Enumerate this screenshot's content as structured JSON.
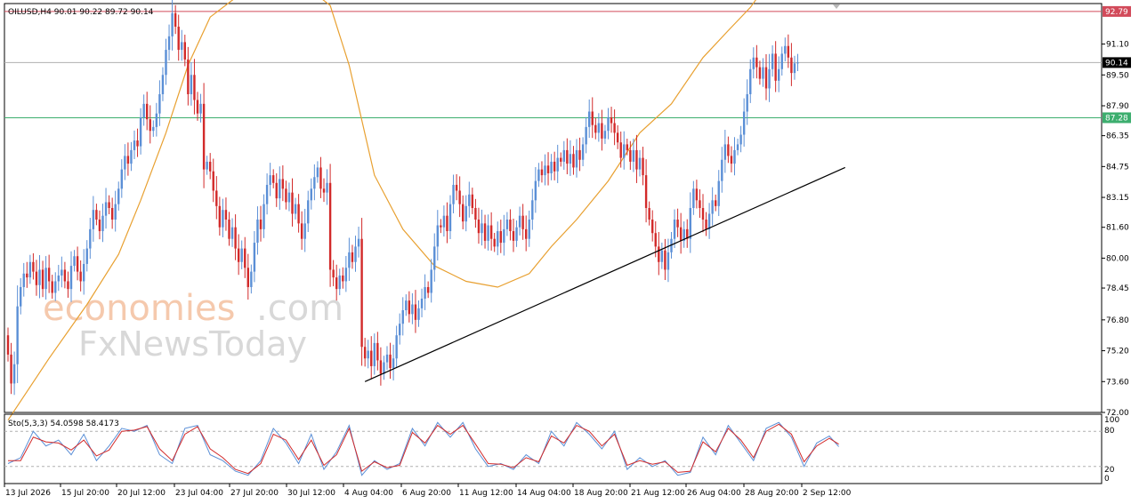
{
  "header": {
    "symbol_line": "OILUSD,H4  90.01 90.22 89.72 90.14",
    "stoch_line": "Sto(5,3,3) 54.0598 58.4173"
  },
  "watermark": {
    "brand_a": "economies",
    "brand_b": ".com",
    "brand_c": "FxNewsToday"
  },
  "colors": {
    "bull": "#5b8fd6",
    "bear": "#d22a2a",
    "ma": "#e8a030",
    "resistance": "#d24a5a",
    "support": "#3cae6e",
    "price_line": "#b0b0b0",
    "trend": "#000000",
    "stoch_main": "#5b8fd6",
    "stoch_signal": "#d22a2a"
  },
  "chart_data": {
    "type": "candlestick",
    "symbol": "OILUSD",
    "timeframe": "H4",
    "ohlc_last": {
      "open": 90.01,
      "high": 90.22,
      "low": 89.72,
      "close": 90.14
    },
    "ylim": [
      72.0,
      93.2
    ],
    "y_ticks": [
      "91.10",
      "89.50",
      "87.90",
      "86.35",
      "84.75",
      "83.15",
      "81.60",
      "80.00",
      "78.45",
      "76.80",
      "75.20",
      "73.60",
      "72.00"
    ],
    "x_ticks": [
      "13 Jul 2026",
      "15 Jul 20:00",
      "20 Jul 12:00",
      "23 Jul 04:00",
      "27 Jul 20:00",
      "30 Jul 12:00",
      "4 Aug 04:00",
      "6 Aug 20:00",
      "11 Aug 12:00",
      "14 Aug 04:00",
      "18 Aug 20:00",
      "21 Aug 12:00",
      "26 Aug 04:00",
      "28 Aug 20:00",
      "2 Sep 12:00"
    ],
    "levels": [
      {
        "label": "92.79",
        "value": 92.79,
        "kind": "resistance"
      },
      {
        "label": "90.14",
        "value": 90.14,
        "kind": "current"
      },
      {
        "label": "87.28",
        "value": 87.28,
        "kind": "support"
      }
    ],
    "closes": [
      75.0,
      73.5,
      74.5,
      77.5,
      78.5,
      79.2,
      79.0,
      79.8,
      79.3,
      78.6,
      79.4,
      78.4,
      79.5,
      78.8,
      78.2,
      78.8,
      79.1,
      79.4,
      78.8,
      78.4,
      79.6,
      80.1,
      79.3,
      78.8,
      79.7,
      80.5,
      81.5,
      82.5,
      82.0,
      81.4,
      82.2,
      82.9,
      82.6,
      82.0,
      82.8,
      83.6,
      84.6,
      85.3,
      84.9,
      85.6,
      86.1,
      85.8,
      87.3,
      88.0,
      87.2,
      86.6,
      86.8,
      87.5,
      88.5,
      89.5,
      90.8,
      91.5,
      92.7,
      92.0,
      90.8,
      91.2,
      90.3,
      88.5,
      89.5,
      88.2,
      87.5,
      88.0,
      84.6,
      85.0,
      84.5,
      83.5,
      82.7,
      81.6,
      82.5,
      82.0,
      81.0,
      81.6,
      80.5,
      79.8,
      80.5,
      79.5,
      78.5,
      79.3,
      80.8,
      82.0,
      81.5,
      82.8,
      83.8,
      84.3,
      83.9,
      83.1,
      84.1,
      83.6,
      82.9,
      83.4,
      82.3,
      82.8,
      81.8,
      81.0,
      81.8,
      83.0,
      83.6,
      84.2,
      84.7,
      83.6,
      83.4,
      83.9,
      79.4,
      79.0,
      78.4,
      79.1,
      78.8,
      79.5,
      80.3,
      79.8,
      80.6,
      81.0,
      75.4,
      74.8,
      75.2,
      74.4,
      75.6,
      74.7,
      74.0,
      74.6,
      75.0,
      74.3,
      74.8,
      76.0,
      76.6,
      77.3,
      77.8,
      77.1,
      77.6,
      76.8,
      77.4,
      77.9,
      78.5,
      78.2,
      79.4,
      80.6,
      81.7,
      81.6,
      82.2,
      81.4,
      82.8,
      83.8,
      83.5,
      82.8,
      81.9,
      82.7,
      83.3,
      82.6,
      82.0,
      81.3,
      81.8,
      80.9,
      81.7,
      81.0,
      80.6,
      81.4,
      80.8,
      81.5,
      82.0,
      81.4,
      80.9,
      81.6,
      82.2,
      81.5,
      81.0,
      82.0,
      83.0,
      84.0,
      84.6,
      84.3,
      84.8,
      84.4,
      85.0,
      84.5,
      85.2,
      85.0,
      85.6,
      84.9,
      85.4,
      84.7,
      85.6,
      85.1,
      85.9,
      86.8,
      87.6,
      86.9,
      86.5,
      87.0,
      86.2,
      86.6,
      87.3,
      87.0,
      86.5,
      86.0,
      85.2,
      85.9,
      85.6,
      85.0,
      85.6,
      84.6,
      85.2,
      84.3,
      82.6,
      82.0,
      81.3,
      80.6,
      79.8,
      80.4,
      79.4,
      80.3,
      81.0,
      82.0,
      81.6,
      80.9,
      81.5,
      81.0,
      82.6,
      83.6,
      83.0,
      82.6,
      82.0,
      81.5,
      82.3,
      83.0,
      82.7,
      84.0,
      85.1,
      85.9,
      85.3,
      84.9,
      85.6,
      85.9,
      86.4,
      87.6,
      88.5,
      89.8,
      90.4,
      89.9,
      89.3,
      89.9,
      88.8,
      89.8,
      90.6,
      89.2,
      89.8,
      90.6,
      91.0,
      90.4,
      89.6,
      90.1,
      90.14
    ],
    "ma_points": [
      [
        0,
        71.6
      ],
      [
        13,
        74.8
      ],
      [
        25,
        77.6
      ],
      [
        35,
        80.2
      ],
      [
        42,
        83.0
      ],
      [
        50,
        86.5
      ],
      [
        57,
        90.0
      ],
      [
        64,
        92.5
      ],
      [
        72,
        93.5
      ],
      [
        80,
        94.6
      ],
      [
        92,
        94.4
      ],
      [
        102,
        93.1
      ],
      [
        108,
        90.0
      ],
      [
        116,
        84.3
      ],
      [
        125,
        81.5
      ],
      [
        135,
        79.6
      ],
      [
        145,
        78.8
      ],
      [
        155,
        78.5
      ],
      [
        165,
        79.2
      ],
      [
        172,
        80.6
      ],
      [
        180,
        82.0
      ],
      [
        190,
        84.0
      ],
      [
        200,
        86.5
      ],
      [
        210,
        88.0
      ],
      [
        220,
        90.4
      ],
      [
        228,
        91.8
      ],
      [
        235,
        93.0
      ],
      [
        242,
        94.6
      ],
      [
        252,
        97.0
      ]
    ],
    "trendline": [
      [
        113,
        73.6
      ],
      [
        265,
        84.7
      ]
    ],
    "stochastic": {
      "label": "Sto(5,3,3)",
      "main_last": 54.0598,
      "signal_last": 58.4173,
      "levels": [
        20,
        80
      ],
      "ylim": [
        0,
        100
      ],
      "y_ticks": [
        "100",
        "80",
        "20",
        "0"
      ],
      "main_points": [
        [
          0,
          25
        ],
        [
          4,
          35
        ],
        [
          8,
          80
        ],
        [
          12,
          55
        ],
        [
          16,
          65
        ],
        [
          20,
          40
        ],
        [
          24,
          75
        ],
        [
          28,
          30
        ],
        [
          32,
          55
        ],
        [
          36,
          85
        ],
        [
          40,
          80
        ],
        [
          44,
          90
        ],
        [
          48,
          40
        ],
        [
          52,
          25
        ],
        [
          56,
          85
        ],
        [
          60,
          90
        ],
        [
          64,
          40
        ],
        [
          68,
          30
        ],
        [
          72,
          12
        ],
        [
          76,
          5
        ],
        [
          80,
          30
        ],
        [
          84,
          85
        ],
        [
          88,
          60
        ],
        [
          92,
          25
        ],
        [
          96,
          75
        ],
        [
          100,
          15
        ],
        [
          104,
          45
        ],
        [
          108,
          90
        ],
        [
          112,
          5
        ],
        [
          116,
          30
        ],
        [
          120,
          15
        ],
        [
          124,
          25
        ],
        [
          128,
          85
        ],
        [
          132,
          55
        ],
        [
          136,
          95
        ],
        [
          140,
          70
        ],
        [
          144,
          95
        ],
        [
          148,
          50
        ],
        [
          152,
          20
        ],
        [
          156,
          25
        ],
        [
          160,
          15
        ],
        [
          164,
          40
        ],
        [
          168,
          25
        ],
        [
          172,
          80
        ],
        [
          176,
          55
        ],
        [
          180,
          95
        ],
        [
          184,
          75
        ],
        [
          188,
          50
        ],
        [
          192,
          80
        ],
        [
          196,
          15
        ],
        [
          200,
          35
        ],
        [
          204,
          20
        ],
        [
          208,
          30
        ],
        [
          212,
          5
        ],
        [
          216,
          10
        ],
        [
          220,
          70
        ],
        [
          224,
          40
        ],
        [
          228,
          90
        ],
        [
          232,
          60
        ],
        [
          236,
          30
        ],
        [
          240,
          85
        ],
        [
          244,
          95
        ],
        [
          248,
          70
        ],
        [
          252,
          20
        ],
        [
          256,
          60
        ],
        [
          260,
          72
        ],
        [
          263,
          54
        ]
      ],
      "signal_points": [
        [
          0,
          30
        ],
        [
          4,
          30
        ],
        [
          8,
          70
        ],
        [
          12,
          62
        ],
        [
          16,
          60
        ],
        [
          20,
          48
        ],
        [
          24,
          65
        ],
        [
          28,
          38
        ],
        [
          32,
          48
        ],
        [
          36,
          80
        ],
        [
          40,
          82
        ],
        [
          44,
          88
        ],
        [
          48,
          50
        ],
        [
          52,
          30
        ],
        [
          56,
          75
        ],
        [
          60,
          88
        ],
        [
          64,
          50
        ],
        [
          68,
          35
        ],
        [
          72,
          15
        ],
        [
          76,
          8
        ],
        [
          80,
          25
        ],
        [
          84,
          75
        ],
        [
          88,
          65
        ],
        [
          92,
          32
        ],
        [
          96,
          65
        ],
        [
          100,
          22
        ],
        [
          104,
          40
        ],
        [
          108,
          85
        ],
        [
          112,
          12
        ],
        [
          116,
          28
        ],
        [
          120,
          18
        ],
        [
          124,
          22
        ],
        [
          128,
          78
        ],
        [
          132,
          60
        ],
        [
          136,
          90
        ],
        [
          140,
          75
        ],
        [
          144,
          90
        ],
        [
          148,
          58
        ],
        [
          152,
          25
        ],
        [
          156,
          24
        ],
        [
          160,
          18
        ],
        [
          164,
          35
        ],
        [
          168,
          28
        ],
        [
          172,
          72
        ],
        [
          176,
          60
        ],
        [
          180,
          90
        ],
        [
          184,
          80
        ],
        [
          188,
          55
        ],
        [
          192,
          75
        ],
        [
          196,
          22
        ],
        [
          200,
          30
        ],
        [
          204,
          24
        ],
        [
          208,
          28
        ],
        [
          212,
          10
        ],
        [
          216,
          12
        ],
        [
          220,
          62
        ],
        [
          224,
          45
        ],
        [
          228,
          85
        ],
        [
          232,
          65
        ],
        [
          236,
          35
        ],
        [
          240,
          80
        ],
        [
          244,
          92
        ],
        [
          248,
          75
        ],
        [
          252,
          28
        ],
        [
          256,
          55
        ],
        [
          260,
          68
        ],
        [
          263,
          58
        ]
      ]
    }
  }
}
